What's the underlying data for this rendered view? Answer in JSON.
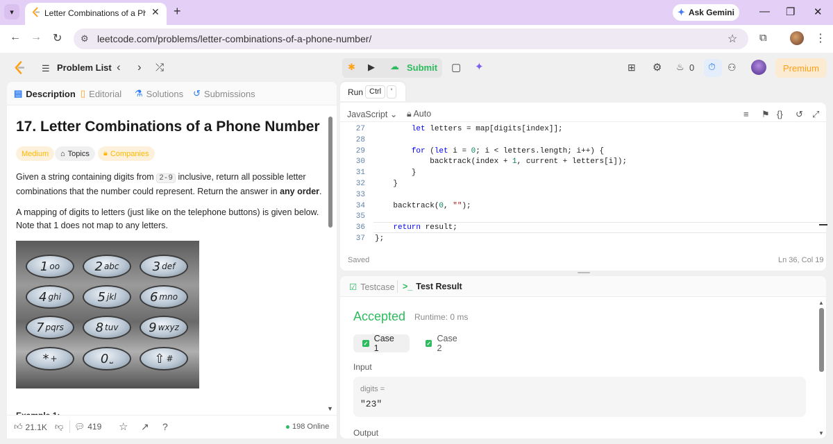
{
  "browser": {
    "tab_title": "Letter Combinations of a Phone Number",
    "new_tab": "+",
    "gemini_label": "Ask Gemini",
    "url": "leetcode.com/problems/letter-combinations-of-a-phone-number/",
    "colors": {
      "tabstrip": "#e4cff7",
      "omnibox": "#efe9f4"
    }
  },
  "topbar": {
    "problem_list": "Problem List",
    "submit": "Submit",
    "streak_count": "0",
    "premium": "Premium",
    "accent": "#ffa116",
    "submit_color": "#2cbb5d"
  },
  "left_tabs": {
    "description": "Description",
    "editorial": "Editorial",
    "solutions": "Solutions",
    "submissions": "Submissions"
  },
  "problem": {
    "title": "17. Letter Combinations of a Phone Number",
    "difficulty": "Medium",
    "topics": "Topics",
    "companies": "Companies",
    "para1_a": "Given a string containing digits from ",
    "para1_code": "2-9",
    "para1_b": " inclusive, return all possible letter combinations that the number could represent. Return the answer in ",
    "para1_bold": "any order",
    "para1_end": ".",
    "para2": "A mapping of digits to letters (just like on the telephone buttons) is given below. Note that 1 does not map to any letters.",
    "example_heading": "Example 1:",
    "keypad": [
      {
        "d": "1",
        "l": "oo"
      },
      {
        "d": "2",
        "l": "abc"
      },
      {
        "d": "3",
        "l": "def"
      },
      {
        "d": "4",
        "l": "ghi"
      },
      {
        "d": "5",
        "l": "jkl"
      },
      {
        "d": "6",
        "l": "mno"
      },
      {
        "d": "7",
        "l": "pqrs"
      },
      {
        "d": "8",
        "l": "tuv"
      },
      {
        "d": "9",
        "l": "wxyz"
      },
      {
        "d": "*",
        "l": "+"
      },
      {
        "d": "0",
        "l": "⎵"
      },
      {
        "d": "⇧",
        "l": "#"
      }
    ]
  },
  "left_bottom": {
    "likes": "21.1K",
    "comments": "419",
    "online": "198 Online"
  },
  "editor": {
    "run_tooltip": "Run",
    "kbd_ctrl": "Ctrl",
    "kbd_key": "'",
    "language": "JavaScript",
    "auto": "Auto",
    "lines": [
      {
        "n": "27",
        "indent": "        ",
        "tokens": [
          [
            "kw",
            "let"
          ],
          [
            "p",
            " letters = map[digits[index]];"
          ]
        ]
      },
      {
        "n": "28",
        "indent": "",
        "tokens": []
      },
      {
        "n": "29",
        "indent": "        ",
        "tokens": [
          [
            "kw",
            "for"
          ],
          [
            "p",
            " ("
          ],
          [
            "kw",
            "let"
          ],
          [
            "p",
            " i = "
          ],
          [
            "num",
            "0"
          ],
          [
            "p",
            "; i < letters.length; i++) {"
          ]
        ]
      },
      {
        "n": "30",
        "indent": "            ",
        "tokens": [
          [
            "p",
            "backtrack(index + "
          ],
          [
            "num",
            "1"
          ],
          [
            "p",
            ", current + letters[i]);"
          ]
        ]
      },
      {
        "n": "31",
        "indent": "        ",
        "tokens": [
          [
            "p",
            "}"
          ]
        ]
      },
      {
        "n": "32",
        "indent": "    ",
        "tokens": [
          [
            "p",
            "}"
          ]
        ]
      },
      {
        "n": "33",
        "indent": "",
        "tokens": []
      },
      {
        "n": "34",
        "indent": "    ",
        "tokens": [
          [
            "p",
            "backtrack("
          ],
          [
            "num",
            "0"
          ],
          [
            "p",
            ", "
          ],
          [
            "str",
            "\"\""
          ],
          [
            "p",
            ");"
          ]
        ]
      },
      {
        "n": "35",
        "indent": "",
        "tokens": []
      },
      {
        "n": "36",
        "indent": "    ",
        "tokens": [
          [
            "kw",
            "return"
          ],
          [
            "p",
            " result;"
          ]
        ]
      },
      {
        "n": "37",
        "indent": "",
        "tokens": [
          [
            "p",
            "};"
          ]
        ]
      }
    ],
    "saved": "Saved",
    "cursor": "Ln 36, Col 19"
  },
  "result": {
    "testcase_tab": "Testcase",
    "testresult_tab": "Test Result",
    "status": "Accepted",
    "runtime": "Runtime: 0 ms",
    "case1": "Case 1",
    "case2": "Case 2",
    "input_label": "Input",
    "input_var": "digits =",
    "input_value": "\"23\"",
    "output_label": "Output"
  }
}
